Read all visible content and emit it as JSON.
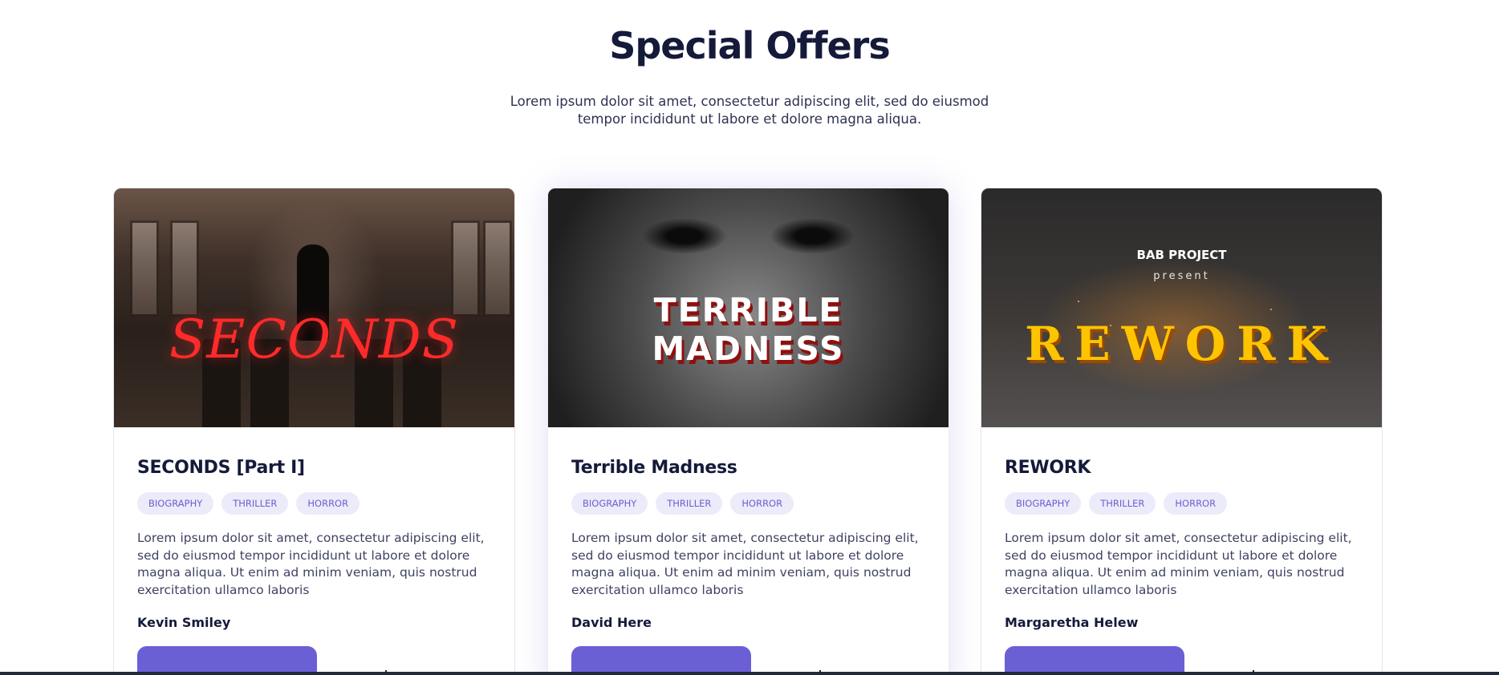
{
  "section": {
    "title": "Special Offers",
    "subtitle": "Lorem ipsum dolor sit amet, consectetur adipiscing elit, sed do eiusmod tempor incididunt ut labore et dolore magna aliqua."
  },
  "cards": [
    {
      "title": "SECONDS [Part I]",
      "cover_text": "SECONDS",
      "tags": [
        "BIOGRAPHY",
        "THRILLER",
        "HORROR"
      ],
      "description": "Lorem ipsum dolor sit amet, consectetur adipiscing elit, sed do eiusmod tempor incididunt ut labore et dolore magna aliqua. Ut enim ad minim veniam, quis nostrud exercitation ullamco laboris",
      "author": "Kevin Smiley"
    },
    {
      "title": "Terrible Madness",
      "cover_text_line1": "TERRIBLE",
      "cover_text_line2": "MADNESS",
      "tags": [
        "BIOGRAPHY",
        "THRILLER",
        "HORROR"
      ],
      "description": "Lorem ipsum dolor sit amet, consectetur adipiscing elit, sed do eiusmod tempor incididunt ut labore et dolore magna aliqua. Ut enim ad minim veniam, quis nostrud exercitation ullamco laboris",
      "author": "David Here"
    },
    {
      "title": "REWORK",
      "cover_pretitle": "BAB PROJECT",
      "cover_present": "present",
      "cover_text": "REWORK",
      "tags": [
        "BIOGRAPHY",
        "THRILLER",
        "HORROR"
      ],
      "description": "Lorem ipsum dolor sit amet, consectetur adipiscing elit, sed do eiusmod tempor incididunt ut labore et dolore magna aliqua. Ut enim ad minim veniam, quis nostrud exercitation ullamco laboris",
      "author": "Margaretha Helew"
    }
  ],
  "colors": {
    "heading": "#151a3a",
    "accent": "#6b5fd6",
    "tag_bg": "#ecebfa",
    "tag_text": "#6a60cf"
  }
}
